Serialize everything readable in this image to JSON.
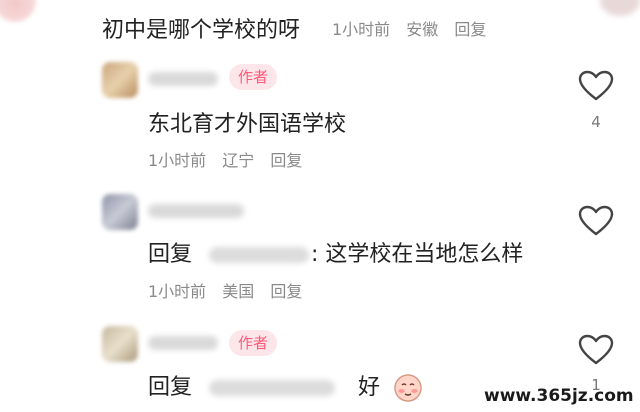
{
  "top_comment": {
    "text": "初中是哪个学校的呀",
    "time": "1小时前",
    "location": "安徽",
    "reply_label": "回复"
  },
  "comments": [
    {
      "badge": "作者",
      "text": "东北育才外国语学校",
      "time": "1小时前",
      "location": "辽宁",
      "reply_label": "回复",
      "likes": "4"
    },
    {
      "reply_prefix": "回复",
      "text": "这学校在当地怎么样",
      "time": "1小时前",
      "location": "美国",
      "reply_label": "回复"
    },
    {
      "badge": "作者",
      "reply_prefix": "回复",
      "text": "好",
      "likes": "1"
    }
  ],
  "watermark": "www.365jz.com",
  "icons": {
    "like": "heart-outline-icon",
    "emoji": "blushing-face-emoji-icon"
  },
  "colors": {
    "badge_bg": "#fde6ea",
    "badge_text": "#ff5a7a",
    "meta_text": "#8a8a8a"
  }
}
